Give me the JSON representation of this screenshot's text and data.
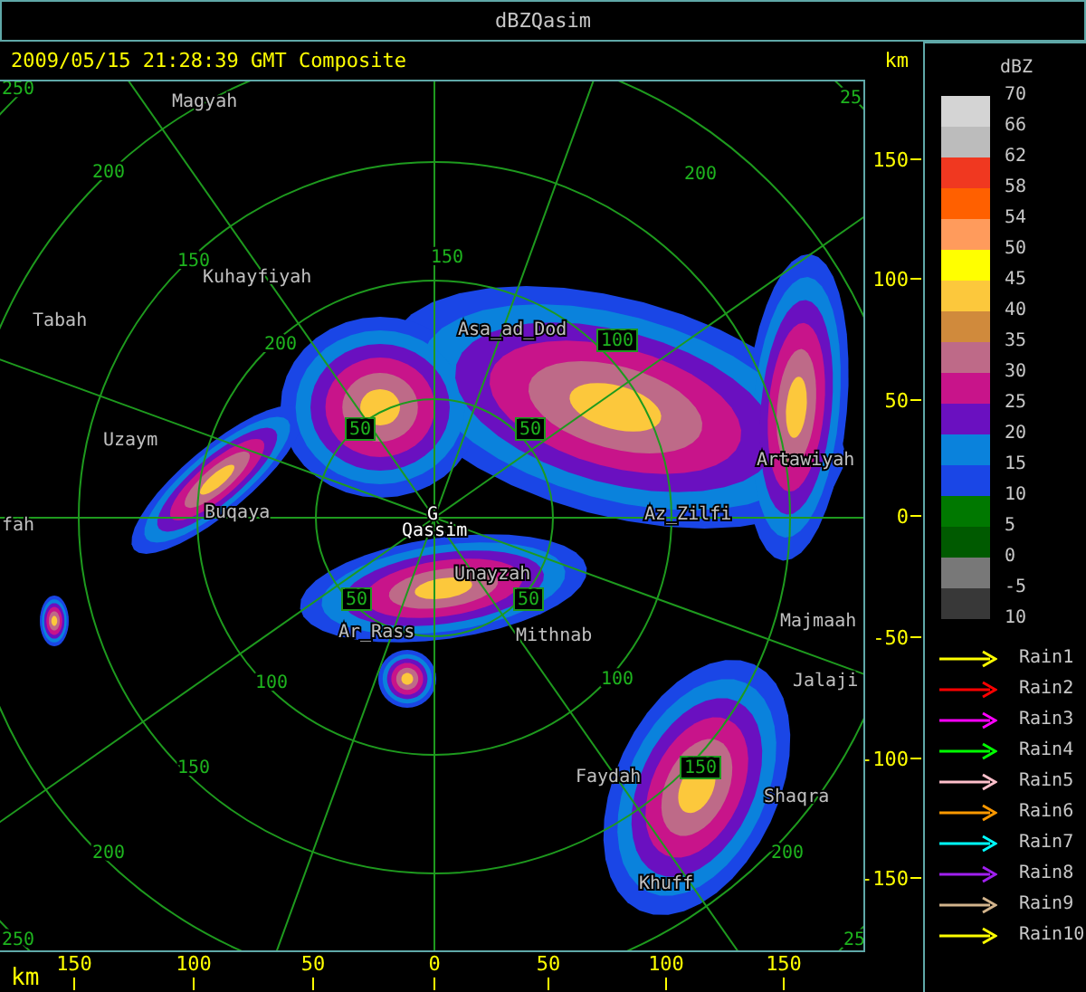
{
  "window": {
    "title": "dBZQasim"
  },
  "header": {
    "timestamp": "2009/05/15 21:28:39 GMT Composite",
    "unit": "km"
  },
  "map": {
    "cities": [
      {
        "name": "Magyah",
        "highlight": false
      },
      {
        "name": "Kuhayfiyah",
        "highlight": false
      },
      {
        "name": "Tabah",
        "highlight": false
      },
      {
        "name": "Uzaym",
        "highlight": false
      },
      {
        "name": "fah",
        "highlight": false
      },
      {
        "name": "Buqaya",
        "highlight": false
      },
      {
        "name": "G",
        "highlight": true
      },
      {
        "name": "Qassim",
        "highlight": true
      },
      {
        "name": "Asa_ad_Dod",
        "highlight": false
      },
      {
        "name": "Az_Zilfi",
        "highlight": false
      },
      {
        "name": "Artawiyah",
        "highlight": false
      },
      {
        "name": "Unayzah",
        "highlight": false
      },
      {
        "name": "Ar_Rass",
        "highlight": false
      },
      {
        "name": "Mithnab",
        "highlight": false
      },
      {
        "name": "Majmaah",
        "highlight": false
      },
      {
        "name": "Jalaji",
        "highlight": false
      },
      {
        "name": "Faydah",
        "highlight": false
      },
      {
        "name": "Shaqra",
        "highlight": false
      },
      {
        "name": "Khuff",
        "highlight": false
      }
    ],
    "ring_labels": [
      {
        "text": "50",
        "boxed": true
      },
      {
        "text": "50",
        "boxed": true
      },
      {
        "text": "50",
        "boxed": true
      },
      {
        "text": "50",
        "boxed": true
      },
      {
        "text": "100",
        "boxed": true
      },
      {
        "text": "150",
        "boxed": true
      },
      {
        "text": "100",
        "boxed": false
      },
      {
        "text": "100",
        "boxed": false
      },
      {
        "text": "150",
        "boxed": false
      },
      {
        "text": "200",
        "boxed": false
      },
      {
        "text": "200",
        "boxed": false
      },
      {
        "text": "150",
        "boxed": false
      },
      {
        "text": "200",
        "boxed": false
      },
      {
        "text": "200",
        "boxed": false
      },
      {
        "text": "150",
        "boxed": false
      },
      {
        "text": "200",
        "boxed": false
      },
      {
        "text": "25",
        "boxed": false
      },
      {
        "text": "250",
        "boxed": false
      },
      {
        "text": "250",
        "boxed": false
      },
      {
        "text": "25",
        "boxed": false
      }
    ]
  },
  "y_axis": {
    "ticks": [
      "150",
      "100",
      "50",
      "0",
      "-50",
      "-100",
      "-150"
    ]
  },
  "x_axis": {
    "unit": "km",
    "ticks": [
      "150",
      "100",
      "50",
      "0",
      "50",
      "100",
      "150"
    ]
  },
  "legend": {
    "title": "dBZ",
    "scale": [
      {
        "color": "#d4d4d4"
      },
      {
        "color": "#bcbcbc"
      },
      {
        "color": "#f03820"
      },
      {
        "color": "#ff6000"
      },
      {
        "color": "#ff9b5c"
      },
      {
        "color": "#ffff00"
      },
      {
        "color": "#fcc83c"
      },
      {
        "color": "#d08a3c"
      },
      {
        "color": "#be6a88"
      },
      {
        "color": "#c8148a"
      },
      {
        "color": "#6a10c0"
      },
      {
        "color": "#0a82dc"
      },
      {
        "color": "#1a46e6"
      },
      {
        "color": "#007800"
      },
      {
        "color": "#005a00"
      },
      {
        "color": "#787878"
      },
      {
        "color": "#383838"
      }
    ],
    "scale_labels": [
      "70",
      "66",
      "62",
      "58",
      "54",
      "50",
      "45",
      "40",
      "35",
      "30",
      "25",
      "20",
      "15",
      "10",
      "5",
      "0",
      "-5",
      "10"
    ],
    "tracks": [
      {
        "label": "Rain1",
        "color": "#ffff00"
      },
      {
        "label": "Rain2",
        "color": "#ff0000"
      },
      {
        "label": "Rain3",
        "color": "#ff00ff"
      },
      {
        "label": "Rain4",
        "color": "#00ff00"
      },
      {
        "label": "Rain5",
        "color": "#ffc0cb"
      },
      {
        "label": "Rain6",
        "color": "#ff9900"
      },
      {
        "label": "Rain7",
        "color": "#00ffff"
      },
      {
        "label": "Rain8",
        "color": "#a020f0"
      },
      {
        "label": "Rain9",
        "color": "#d2b48c"
      },
      {
        "label": "Rain10",
        "color": "#ffff00"
      }
    ]
  }
}
